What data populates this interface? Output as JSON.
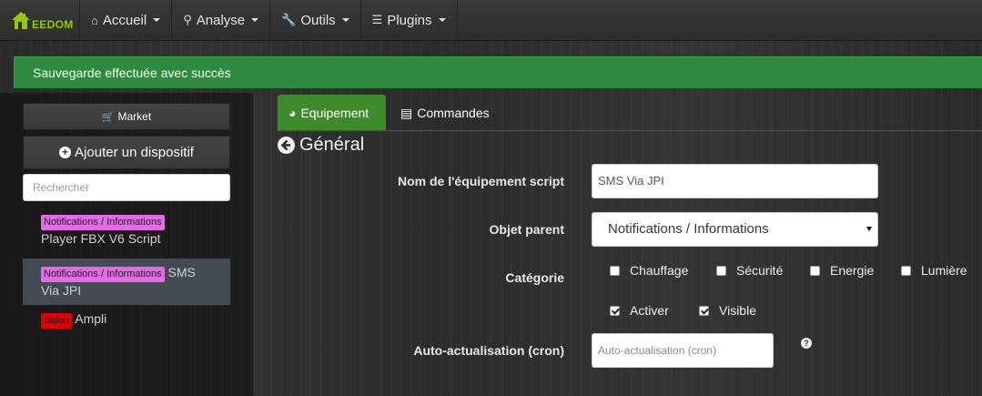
{
  "navbar": {
    "brand_text": "EEDOM",
    "items": [
      {
        "label": "Accueil",
        "icon": "home-icon"
      },
      {
        "label": "Analyse",
        "icon": "analysis-icon"
      },
      {
        "label": "Outils",
        "icon": "wrench-icon"
      },
      {
        "label": "Plugins",
        "icon": "tasks-icon"
      }
    ]
  },
  "alert": {
    "text": "Sauvegarde effectuée avec succès",
    "color": "#2d8a3e"
  },
  "sidebar": {
    "market_label": "Market",
    "add_label": "Ajouter un dispositif",
    "search_placeholder": "Rechercher",
    "items": [
      {
        "tag": "Notifications / Informations",
        "name": "Player FBX V6 Script",
        "tag_color": "#e46ae6"
      },
      {
        "tag": "Notifications / Informations",
        "name": "SMS",
        "name2": "Via JPI",
        "tag_color": "#e46ae6",
        "active": true
      },
      {
        "tag": "Salon",
        "name": "Ampli",
        "tag_color": "#e00000"
      }
    ]
  },
  "tabs": [
    {
      "label": "Equipement",
      "icon": "dashboard-icon"
    },
    {
      "label": "Commandes",
      "icon": "list-icon"
    }
  ],
  "section_title": "Général",
  "form": {
    "name_label": "Nom de l'équipement script",
    "name_value": "SMS Via JPI",
    "parent_label": "Objet parent",
    "parent_value": "Notifications / Informations",
    "category_label": "Catégorie",
    "categories": [
      {
        "label": "Chauffage",
        "checked": false
      },
      {
        "label": "Sécurité",
        "checked": false
      },
      {
        "label": "Energie",
        "checked": false
      },
      {
        "label": "Lumière",
        "checked": false
      }
    ],
    "activer_label": "Activer",
    "visible_label": "Visible",
    "cron_label": "Auto-actualisation (cron)",
    "cron_placeholder": "Auto-actualisation (cron)",
    "help_glyph": "?"
  },
  "colors": {
    "accent": "#94ca02",
    "tab_active": "#3d8b2a"
  }
}
